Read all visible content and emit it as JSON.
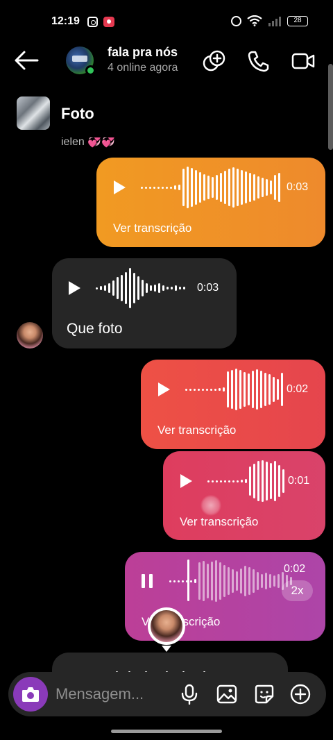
{
  "status_bar": {
    "time": "12:19",
    "battery": "28"
  },
  "header": {
    "title": "fala pra nós",
    "subtitle": "4 online agora"
  },
  "pinned": {
    "label": "Foto",
    "clipped_name": "ielen 💞💞"
  },
  "messages": [
    {
      "side": "right",
      "type": "voice",
      "duration": "0:03",
      "transcript_link": "Ver transcrição",
      "color": "#f19a22"
    },
    {
      "side": "left",
      "type": "voice",
      "duration": "0:03",
      "text": "Que foto",
      "color": "#262626"
    },
    {
      "side": "right",
      "type": "voice",
      "duration": "0:02",
      "transcript_link": "Ver transcrição",
      "color": "#ee5145"
    },
    {
      "side": "right",
      "type": "voice",
      "duration": "0:01",
      "transcript_link": "Ver transcrição",
      "color": "#de3d5e"
    },
    {
      "side": "right",
      "type": "voice",
      "duration": "0:02",
      "speed": "2x",
      "transcript_link": "Ver transcrição",
      "playing": true,
      "color": "#bc3f97"
    }
  ],
  "composer": {
    "placeholder": "Mensagem..."
  },
  "icons": {
    "back": "arrow-left-icon",
    "add_people": "add-people-icon",
    "call": "phone-icon",
    "video": "video-camera-icon",
    "camera": "camera-icon",
    "mic": "microphone-icon",
    "gallery": "gallery-icon",
    "sticker": "sticker-icon",
    "plus": "plus-circle-icon"
  },
  "colors": {
    "online": "#31c45a",
    "camera_button": "#8a3ab9",
    "background": "#000000"
  }
}
